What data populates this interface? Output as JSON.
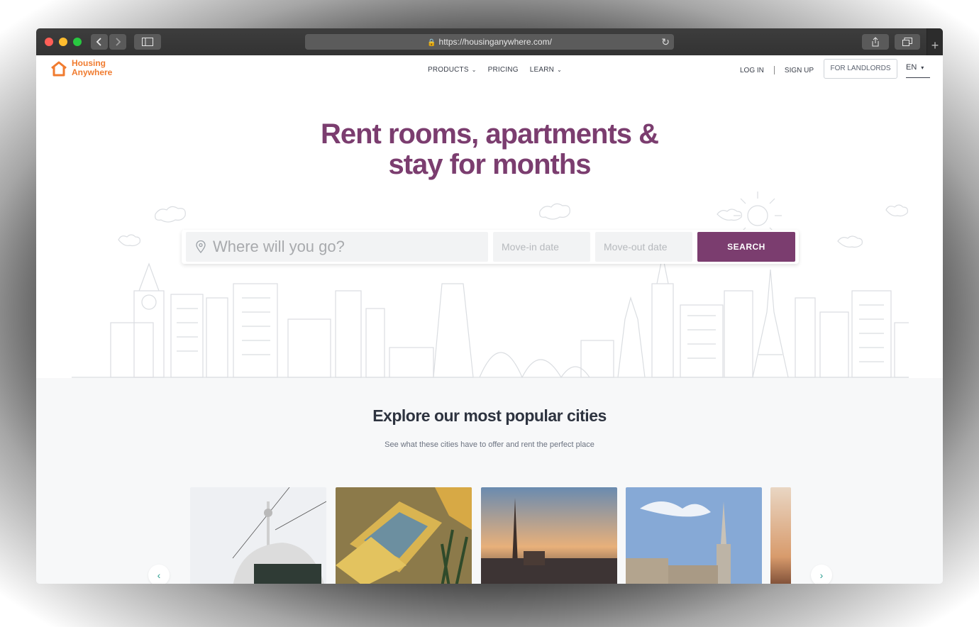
{
  "browser": {
    "url": "https://housinganywhere.com/",
    "back_icon": "chevron-left-icon",
    "forward_icon": "chevron-right-icon",
    "sidebar_icon": "sidebar-icon",
    "share_icon": "share-icon",
    "tabs_icon": "tabs-icon",
    "newtab_icon": "plus-icon"
  },
  "header": {
    "logo_line1": "Housing",
    "logo_line2": "Anywhere",
    "nav": [
      {
        "label": "PRODUCTS",
        "caret": "⌄"
      },
      {
        "label": "PRICING",
        "caret": ""
      },
      {
        "label": "LEARN",
        "caret": "⌄"
      }
    ],
    "login": "LOG IN",
    "signup": "SIGN UP",
    "landlords": "FOR LANDLORDS",
    "lang": "EN",
    "lang_caret": "▾"
  },
  "hero": {
    "title_line1": "Rent rooms, apartments &",
    "title_line2": "stay for months"
  },
  "search": {
    "where_placeholder": "Where will you go?",
    "movein_placeholder": "Move-in date",
    "moveout_placeholder": "Move-out date",
    "button": "SEARCH"
  },
  "cities": {
    "title": "Explore our most popular cities",
    "subtitle": "See what these cities have to offer and rent the perfect place",
    "prev_icon": "‹",
    "next_icon": "›"
  },
  "colors": {
    "brand_purple": "#7b3d6f",
    "brand_orange": "#f07b2f",
    "accent_teal": "#2a9d8f"
  }
}
